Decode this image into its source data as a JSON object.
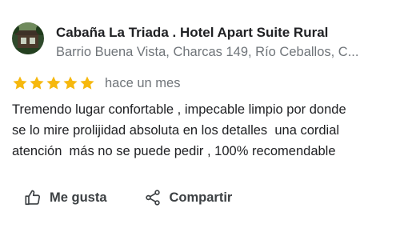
{
  "place": {
    "name": "Cabaña La Triada . Hotel Apart Suite Rural",
    "address": "Barrio Buena Vista, Charcas 149, Río Ceballos, C..."
  },
  "review": {
    "rating": 5,
    "rating_max": 5,
    "date": "hace un mes",
    "text": "Tremendo lugar confortable , impecable limpio por donde\nse lo mire prolijidad absoluta en los detalles  una cordial\natención  más no se puede pedir , 100% recomendable"
  },
  "actions": {
    "like_label": "Me gusta",
    "share_label": "Compartir",
    "like_icon": "thumbs-up-icon",
    "share_icon": "share-icon"
  },
  "colors": {
    "star": "#f6b80d",
    "text_primary": "#202124",
    "text_secondary": "#70757a",
    "icon": "#3c4043"
  }
}
